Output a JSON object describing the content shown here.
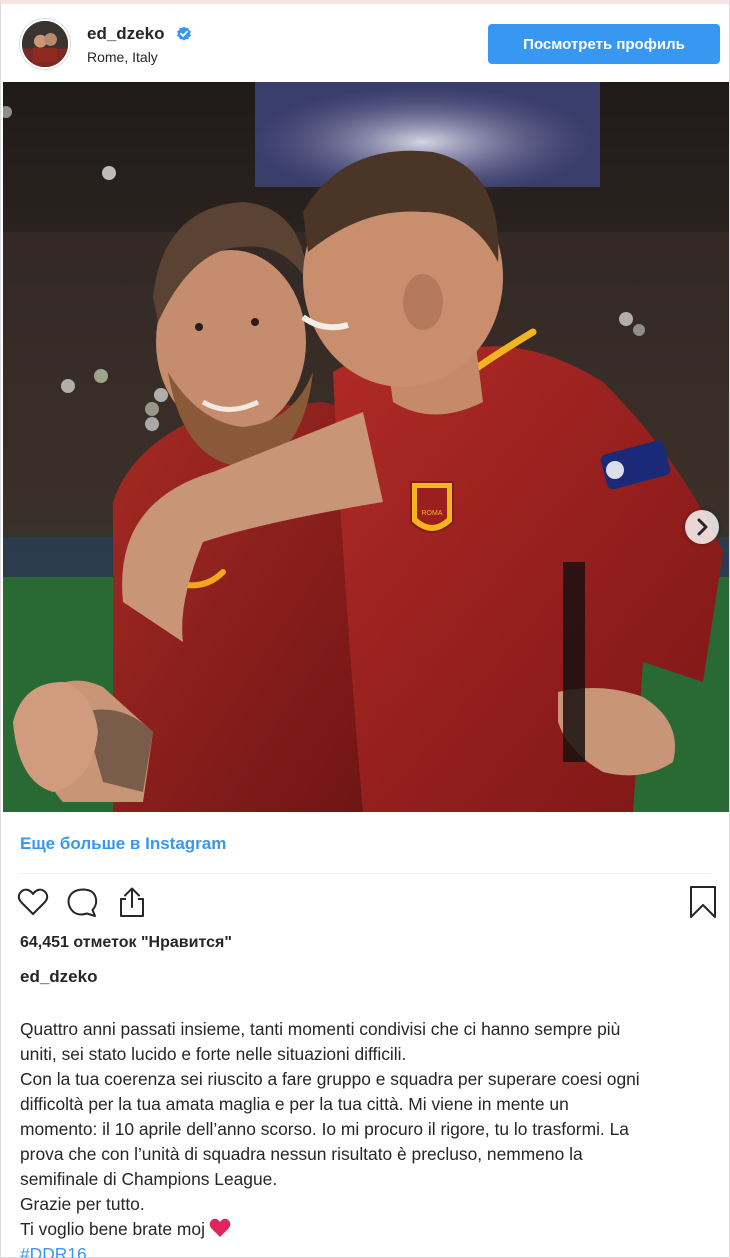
{
  "post": {
    "username": "ed_dzeko",
    "location": "Rome, Italy",
    "view_profile_label": "Посмотреть профиль",
    "more_link": "Еще больше в Instagram",
    "likes_text": "64,451 отметок \"Нравится\"",
    "caption_username": "ed_dzeko",
    "caption_lines": [
      "Quattro anni passati insieme, tanti momenti condivisi che ci hanno sempre più",
      "uniti, sei stato lucido e forte nelle situazioni difficili.",
      "Con la tua coerenza sei riuscito a fare gruppo e squadra per superare coesi ogni",
      "difficoltà per la tua amata maglia e per la tua città. Mi viene in mente un",
      "momento: il 10 aprile dell’anno scorso. Io mi procuro il rigore, tu lo trasformi. La",
      "prova che con l’unità di squadra nessun risultato è precluso, nemmeno la",
      "semifinale di Champions League.",
      "Grazie per tutto.",
      "Ti voglio bene brate moj"
    ],
    "hashtag": "#DDR16",
    "emoji": "red-heart",
    "photo_badge_text": "ROMA"
  },
  "icons": {
    "verified": "verified-badge-icon",
    "like": "heart-icon",
    "comment": "comment-bubble-icon",
    "share": "share-icon",
    "save": "bookmark-icon",
    "next": "chevron-right-icon"
  },
  "colors": {
    "accent": "#3897f0",
    "text": "#262626",
    "jersey": "#8b1d1d",
    "heart": "#e0245e"
  }
}
